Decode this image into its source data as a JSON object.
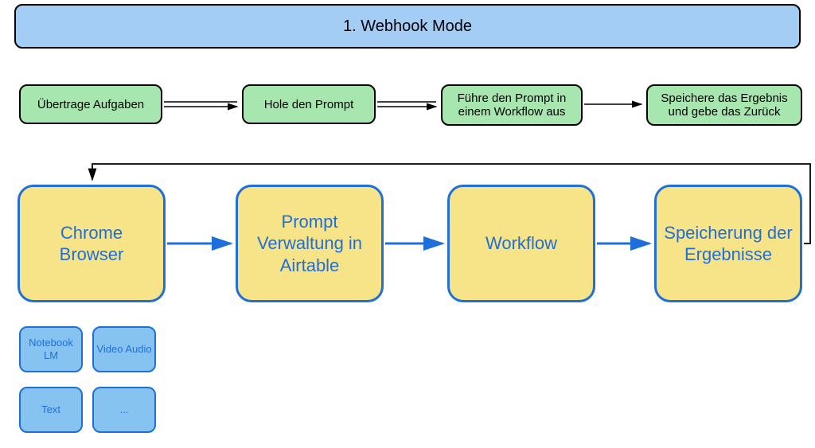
{
  "header": {
    "title": "1. Webhook Mode"
  },
  "green_row": {
    "items": [
      "Übertrage Aufgaben",
      "Hole den Prompt",
      "Führe den Prompt in einem Workflow aus",
      "Speichere das Ergebnis und gebe das Zurück"
    ]
  },
  "yellow_row": {
    "items": [
      "Chrome Browser",
      "Prompt Verwaltung in Airtable",
      "Workflow",
      "Speicherung der Ergebnisse"
    ]
  },
  "blue_small": {
    "items": [
      "Notebook LM",
      "Video Audio",
      "Text",
      "..."
    ]
  }
}
